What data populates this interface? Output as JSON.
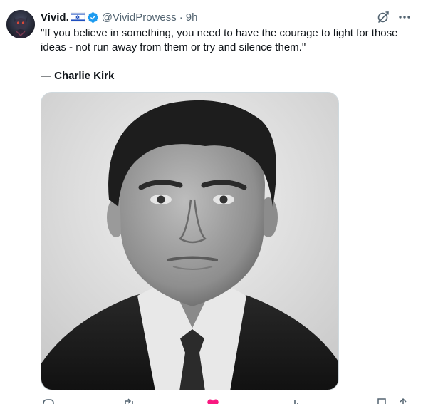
{
  "post": {
    "author": {
      "display_name": "Vivid.",
      "handle": "@VividProwess",
      "flag": "Israel flag",
      "verified": true
    },
    "separator": "·",
    "timestamp": "9h",
    "text": "\"If you believe in something, you need to have the courage to fight for those ideas - not run away from them or try and silence them.\"",
    "attribution": "— Charlie Kirk",
    "media": {
      "description_icon": "portrait-photo"
    }
  },
  "icons": {
    "grok": "grok-icon",
    "more": "more-icon",
    "reply": "reply-icon",
    "repost": "repost-icon",
    "like": "like-icon",
    "views": "views-icon",
    "bookmark": "bookmark-icon",
    "share": "share-icon"
  },
  "colors": {
    "text": "#0f1419",
    "secondary": "#536471",
    "verified": "#1d9bf0",
    "like": "#f91880",
    "border": "#cfd9de"
  }
}
